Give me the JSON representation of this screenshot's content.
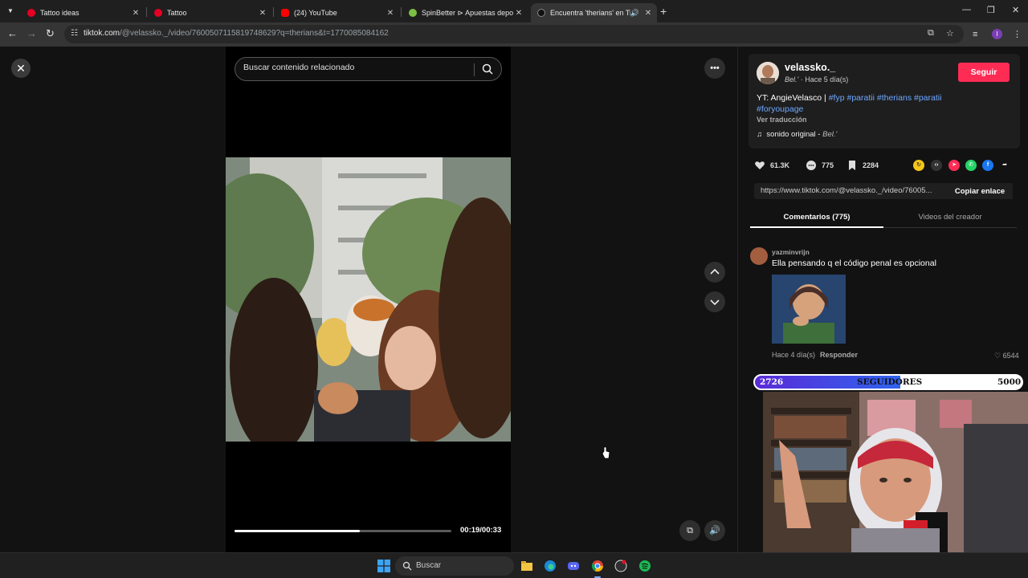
{
  "browser": {
    "tabs": [
      {
        "title": "Tattoo ideas",
        "favicon_color": "#e60023",
        "icon": "pinterest-icon"
      },
      {
        "title": "Tattoo",
        "favicon_color": "#e60023",
        "icon": "pinterest-icon"
      },
      {
        "title": "(24) YouTube",
        "favicon_color": "#ff0000",
        "icon": "youtube-icon"
      },
      {
        "title": "SpinBetter ⊳ Apuestas deportiv",
        "favicon_color": "#7bc043",
        "icon": "spinbetter-icon"
      },
      {
        "title": "Encuentra 'therians' en TikTok",
        "favicon_color": "#ffffff",
        "icon": "tiktok-icon"
      }
    ],
    "url_host": "tiktok.com",
    "url_rest": "/@velassko._/video/7600507115819748629?q=therians&t=1770085084162"
  },
  "video": {
    "search_placeholder": "Buscar contenido relacionado",
    "time": "00:19/00:33",
    "progress": 0.576
  },
  "creator": {
    "username": "velassko._",
    "nickname": "Bel.'",
    "age": "Hace 5 día(s)",
    "follow_label": "Seguir",
    "caption_prefix": "YT: AngieVelasco |",
    "hashtags": [
      "#fyp",
      "#paratii",
      "#therians",
      "#paratii",
      "#foryoupage"
    ],
    "translate": "Ver traducción",
    "sound_name": "sonido original",
    "sound_artist": "Bel.'"
  },
  "stats": {
    "likes": "61.3K",
    "comments": "775",
    "saves": "2284"
  },
  "share": {
    "link": "https://www.tiktok.com/@velassko._/video/76005...",
    "copy_label": "Copiar enlace"
  },
  "panel_tabs": [
    "Comentarios (775)",
    "Videos del creador"
  ],
  "comment": {
    "user": "yazminvrijn",
    "text": "Ella pensando q el código penal es opcional",
    "age": "Hace 4 día(s)",
    "reply_label": "Responder",
    "likes": "6544"
  },
  "follower_goal": {
    "current": "2726",
    "label": "SEGUIDORES",
    "goal": "5000",
    "fraction": 0.545
  },
  "taskbar": {
    "search_label": "Buscar"
  },
  "colors": {
    "accent": "#fe2c55",
    "hashtag": "#6ea8ff"
  }
}
